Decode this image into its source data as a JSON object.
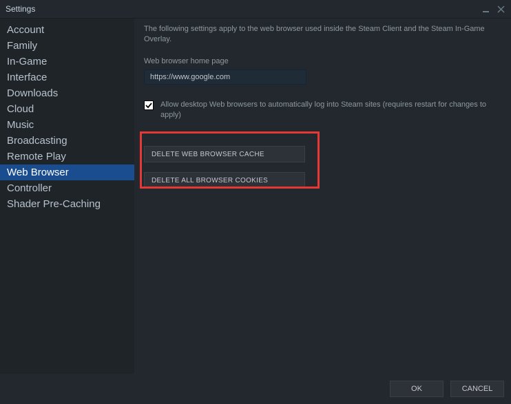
{
  "window": {
    "title": "Settings"
  },
  "sidebar": {
    "items": [
      {
        "label": "Account"
      },
      {
        "label": "Family"
      },
      {
        "label": "In-Game"
      },
      {
        "label": "Interface"
      },
      {
        "label": "Downloads"
      },
      {
        "label": "Cloud"
      },
      {
        "label": "Music"
      },
      {
        "label": "Broadcasting"
      },
      {
        "label": "Remote Play"
      },
      {
        "label": "Web Browser"
      },
      {
        "label": "Controller"
      },
      {
        "label": "Shader Pre-Caching"
      }
    ],
    "selectedIndex": 9
  },
  "content": {
    "description": "The following settings apply to the web browser used inside the Steam Client and the Steam In-Game Overlay.",
    "homepage_label": "Web browser home page",
    "homepage_value": "https://www.google.com",
    "auto_login_label": "Allow desktop Web browsers to automatically log into Steam sites (requires restart for changes to apply)",
    "auto_login_checked": true,
    "delete_cache_label": "DELETE WEB BROWSER CACHE",
    "delete_cookies_label": "DELETE ALL BROWSER COOKIES"
  },
  "footer": {
    "ok": "OK",
    "cancel": "CANCEL"
  }
}
